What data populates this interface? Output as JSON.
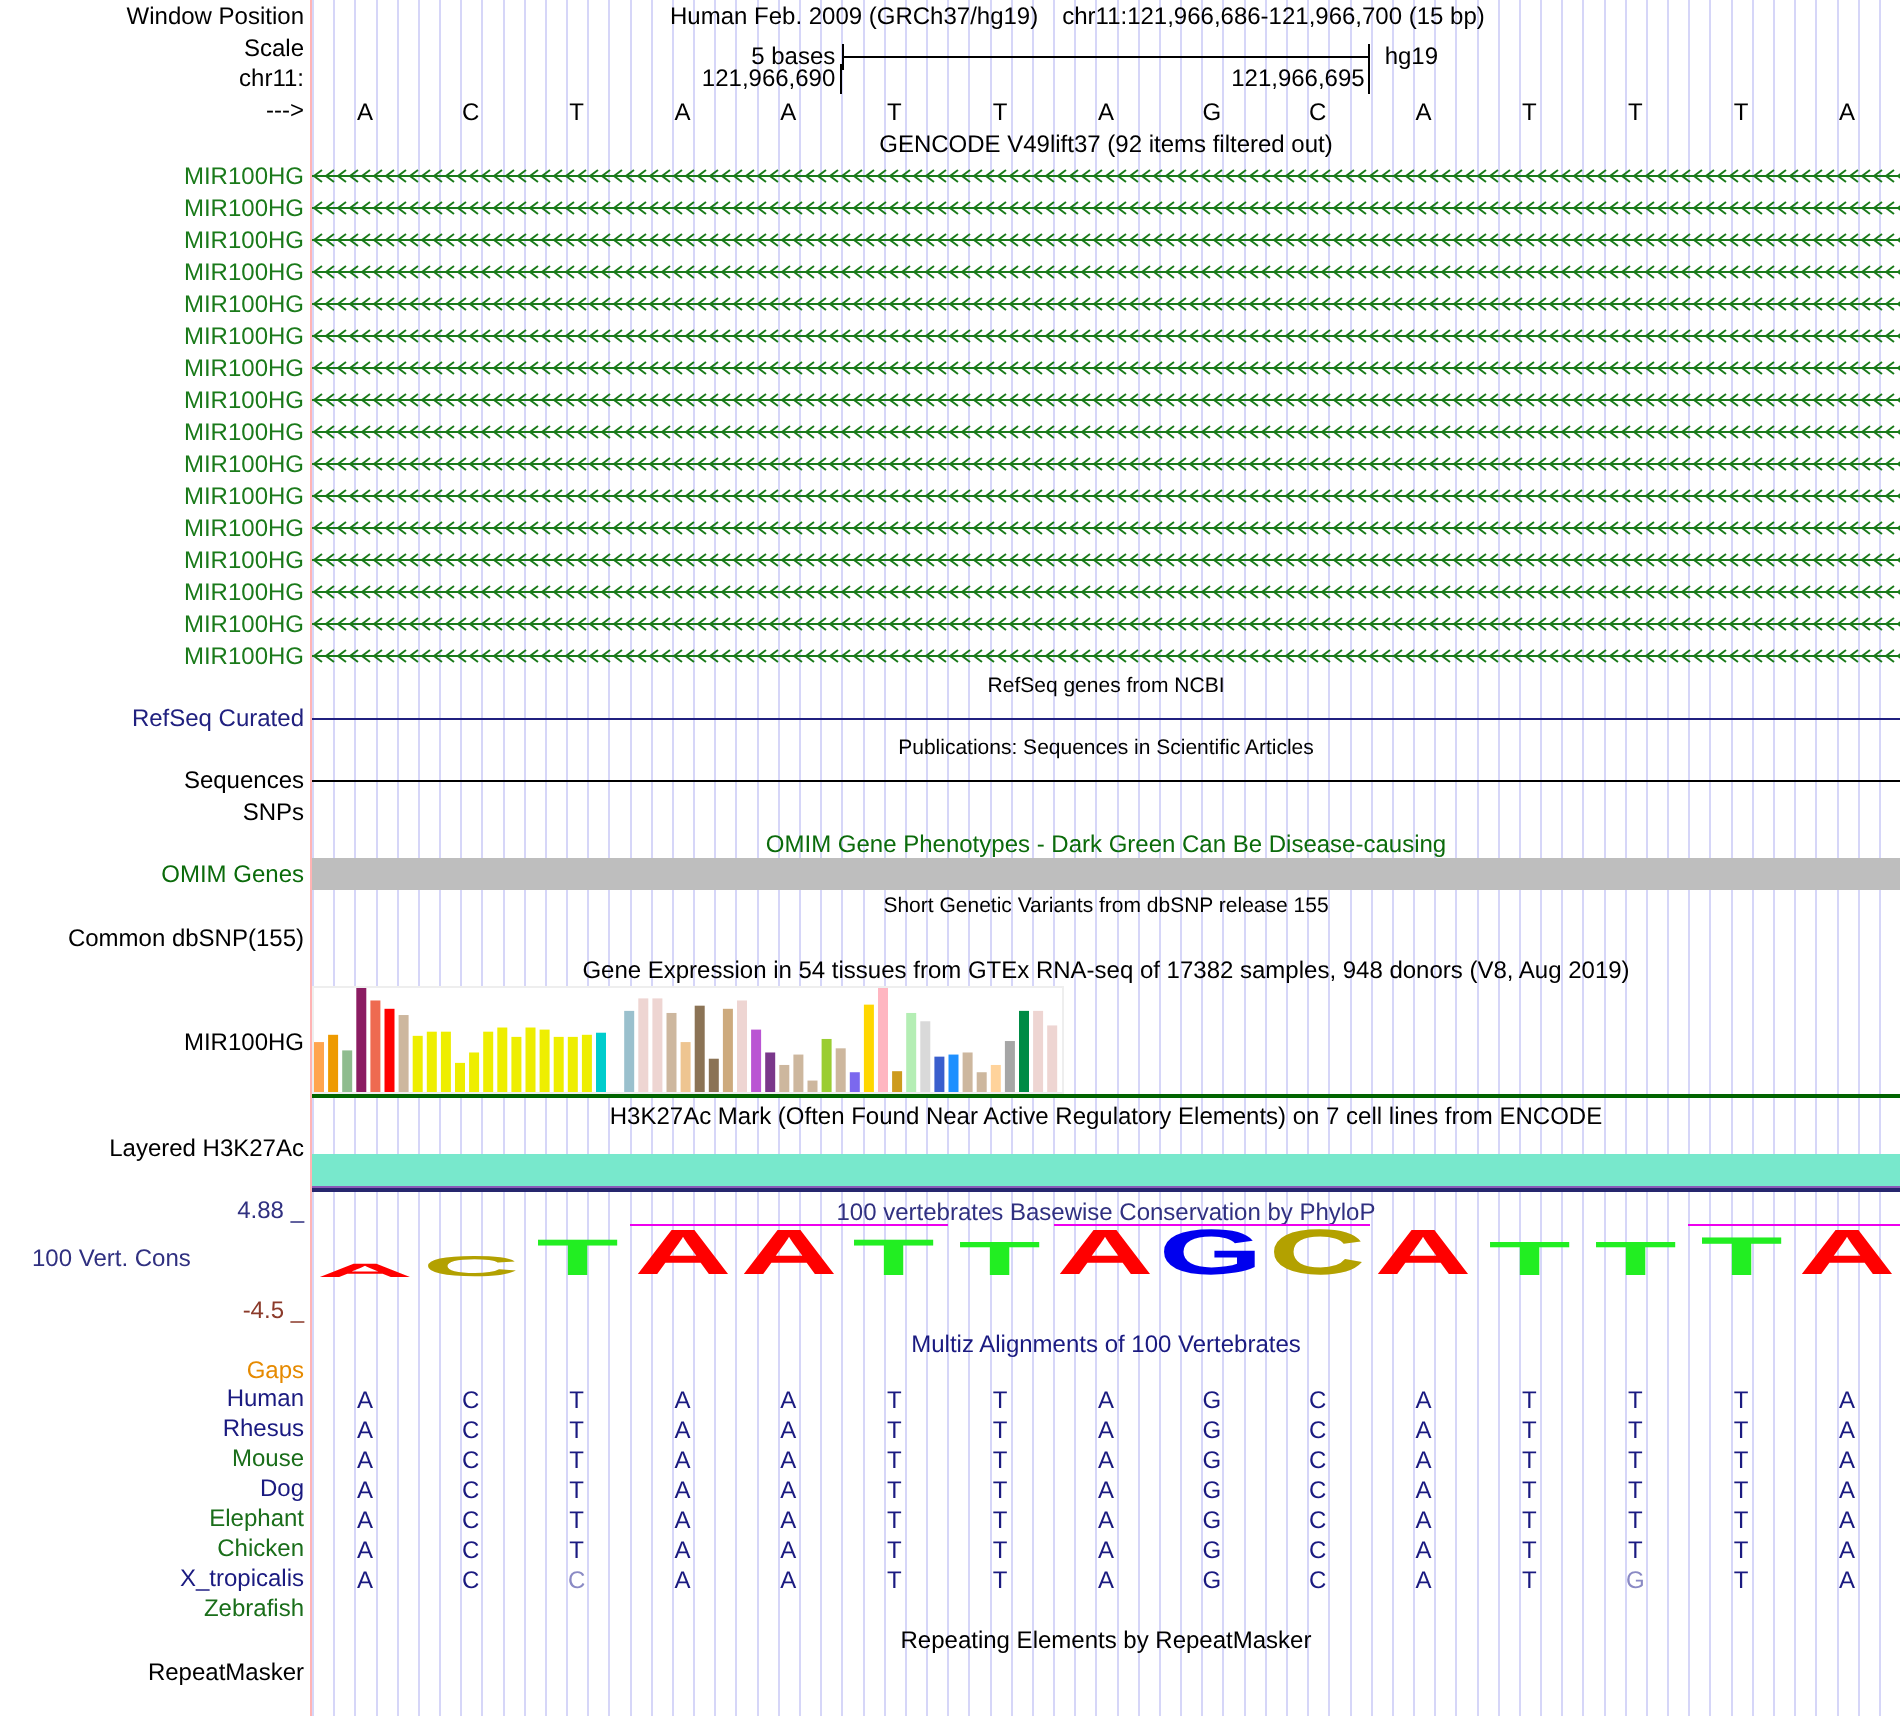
{
  "window_position": {
    "label": "Window Position",
    "assembly": "Human Feb. 2009 (GRCh37/hg19)",
    "range": "chr11:121,966,686-121,966,700 (15 bp)"
  },
  "scale": {
    "label": "Scale",
    "span": "5 bases",
    "assembly": "hg19"
  },
  "coordinates": {
    "label": "chr11:",
    "ticks": [
      "121,966,690",
      "121,966,695"
    ]
  },
  "sequence": {
    "label": "--->",
    "bases": [
      "A",
      "C",
      "T",
      "A",
      "A",
      "T",
      "T",
      "A",
      "G",
      "C",
      "A",
      "T",
      "T",
      "T",
      "A"
    ]
  },
  "tracks": [
    {
      "kind": "genes",
      "title": "GENCODE V49lift37 (92 items filtered out)",
      "items": [
        {
          "label": "MIR100HG",
          "color": "#1a7a1a"
        },
        {
          "label": "MIR100HG",
          "color": "#1a7a1a"
        },
        {
          "label": "MIR100HG",
          "color": "#1a7a1a"
        },
        {
          "label": "MIR100HG",
          "color": "#1a7a1a"
        },
        {
          "label": "MIR100HG",
          "color": "#1a7a1a"
        },
        {
          "label": "MIR100HG",
          "color": "#1a7a1a"
        },
        {
          "label": "MIR100HG",
          "color": "#1a7a1a"
        },
        {
          "label": "MIR100HG",
          "color": "#1a7a1a"
        },
        {
          "label": "MIR100HG",
          "color": "#1a7a1a"
        },
        {
          "label": "MIR100HG",
          "color": "#1a7a1a"
        },
        {
          "label": "MIR100HG",
          "color": "#1a7a1a"
        },
        {
          "label": "MIR100HG",
          "color": "#1a7a1a"
        },
        {
          "label": "MIR100HG",
          "color": "#1a7a1a"
        },
        {
          "label": "MIR100HG",
          "color": "#1a7a1a"
        },
        {
          "label": "MIR100HG",
          "color": "#1a7a1a"
        },
        {
          "label": "MIR100HG",
          "color": "#1a7a1a"
        }
      ]
    },
    {
      "kind": "line",
      "title": "RefSeq genes from NCBI",
      "label": "RefSeq Curated",
      "color": "#20207f"
    },
    {
      "kind": "line",
      "title": "Publications: Sequences in Scientific Articles",
      "label": "Sequences",
      "color": "#000000"
    },
    {
      "kind": "empty",
      "label": "SNPs",
      "color": "#000000"
    },
    {
      "kind": "bar",
      "title": "OMIM Gene Phenotypes - Dark Green Can Be Disease-causing",
      "label": "OMIM Genes",
      "color": "#0b6b0b"
    },
    {
      "kind": "empty",
      "title": "Short Genetic Variants from dbSNP release 155",
      "label": "Common dbSNP(155)",
      "color": "#000000"
    },
    {
      "kind": "expression",
      "title": "Gene Expression in 54 tissues from GTEx RNA-seq of 17382 samples, 948 donors (V8, Aug 2019)",
      "label": "MIR100HG",
      "color": "#000000"
    },
    {
      "kind": "signal",
      "title": "H3K27Ac Mark (Often Found Near Active Regulatory Elements) on 7 cell lines from ENCODE",
      "label": "Layered H3K27Ac",
      "color": "#000000"
    },
    {
      "kind": "conservation",
      "title": "100 vertebrates Basewise Conservation by PhyloP",
      "label": "100 Vert. Cons",
      "color": "#303080",
      "max": "4.88 _",
      "min": "-4.5 _",
      "letters": [
        {
          "base": "A",
          "color": "#ff0000"
        },
        {
          "base": "C",
          "color": "#b3a100"
        },
        {
          "base": "T",
          "color": "#22ee22"
        },
        {
          "base": "A",
          "color": "#ff0000"
        },
        {
          "base": "A",
          "color": "#ff0000"
        },
        {
          "base": "T",
          "color": "#22ee22"
        },
        {
          "base": "T",
          "color": "#22ee22"
        },
        {
          "base": "A",
          "color": "#ff0000"
        },
        {
          "base": "G",
          "color": "#0000ee"
        },
        {
          "base": "C",
          "color": "#b3a100"
        },
        {
          "base": "A",
          "color": "#ff0000"
        },
        {
          "base": "T",
          "color": "#22ee22"
        },
        {
          "base": "T",
          "color": "#22ee22"
        },
        {
          "base": "T",
          "color": "#22ee22"
        },
        {
          "base": "A",
          "color": "#ff0000"
        }
      ]
    },
    {
      "kind": "alignment",
      "title": "Multiz Alignments of 100 Vertebrates",
      "gaps": {
        "label": "Gaps",
        "color": "#e68a00"
      },
      "species": [
        {
          "label": "Human",
          "color": "#1a1a80",
          "bases": [
            {
              "base": "A",
              "faded": false
            },
            {
              "base": "C",
              "faded": false
            },
            {
              "base": "T",
              "faded": false
            },
            {
              "base": "A",
              "faded": false
            },
            {
              "base": "A",
              "faded": false
            },
            {
              "base": "T",
              "faded": false
            },
            {
              "base": "T",
              "faded": false
            },
            {
              "base": "A",
              "faded": false
            },
            {
              "base": "G",
              "faded": false
            },
            {
              "base": "C",
              "faded": false
            },
            {
              "base": "A",
              "faded": false
            },
            {
              "base": "T",
              "faded": false
            },
            {
              "base": "T",
              "faded": false
            },
            {
              "base": "T",
              "faded": false
            },
            {
              "base": "A",
              "faded": false
            }
          ]
        },
        {
          "label": "Rhesus",
          "color": "#1a1a80",
          "bases": [
            {
              "base": "A",
              "faded": false
            },
            {
              "base": "C",
              "faded": false
            },
            {
              "base": "T",
              "faded": false
            },
            {
              "base": "A",
              "faded": false
            },
            {
              "base": "A",
              "faded": false
            },
            {
              "base": "T",
              "faded": false
            },
            {
              "base": "T",
              "faded": false
            },
            {
              "base": "A",
              "faded": false
            },
            {
              "base": "G",
              "faded": false
            },
            {
              "base": "C",
              "faded": false
            },
            {
              "base": "A",
              "faded": false
            },
            {
              "base": "T",
              "faded": false
            },
            {
              "base": "T",
              "faded": false
            },
            {
              "base": "T",
              "faded": false
            },
            {
              "base": "A",
              "faded": false
            }
          ]
        },
        {
          "label": "Mouse",
          "color": "#1a6e1a",
          "bases": [
            {
              "base": "A",
              "faded": false
            },
            {
              "base": "C",
              "faded": false
            },
            {
              "base": "T",
              "faded": false
            },
            {
              "base": "A",
              "faded": false
            },
            {
              "base": "A",
              "faded": false
            },
            {
              "base": "T",
              "faded": false
            },
            {
              "base": "T",
              "faded": false
            },
            {
              "base": "A",
              "faded": false
            },
            {
              "base": "G",
              "faded": false
            },
            {
              "base": "C",
              "faded": false
            },
            {
              "base": "A",
              "faded": false
            },
            {
              "base": "T",
              "faded": false
            },
            {
              "base": "T",
              "faded": false
            },
            {
              "base": "T",
              "faded": false
            },
            {
              "base": "A",
              "faded": false
            }
          ]
        },
        {
          "label": "Dog",
          "color": "#1a1a80",
          "bases": [
            {
              "base": "A",
              "faded": false
            },
            {
              "base": "C",
              "faded": false
            },
            {
              "base": "T",
              "faded": false
            },
            {
              "base": "A",
              "faded": false
            },
            {
              "base": "A",
              "faded": false
            },
            {
              "base": "T",
              "faded": false
            },
            {
              "base": "T",
              "faded": false
            },
            {
              "base": "A",
              "faded": false
            },
            {
              "base": "G",
              "faded": false
            },
            {
              "base": "C",
              "faded": false
            },
            {
              "base": "A",
              "faded": false
            },
            {
              "base": "T",
              "faded": false
            },
            {
              "base": "T",
              "faded": false
            },
            {
              "base": "T",
              "faded": false
            },
            {
              "base": "A",
              "faded": false
            }
          ]
        },
        {
          "label": "Elephant",
          "color": "#1a6e1a",
          "bases": [
            {
              "base": "A",
              "faded": false
            },
            {
              "base": "C",
              "faded": false
            },
            {
              "base": "T",
              "faded": false
            },
            {
              "base": "A",
              "faded": false
            },
            {
              "base": "A",
              "faded": false
            },
            {
              "base": "T",
              "faded": false
            },
            {
              "base": "T",
              "faded": false
            },
            {
              "base": "A",
              "faded": false
            },
            {
              "base": "G",
              "faded": false
            },
            {
              "base": "C",
              "faded": false
            },
            {
              "base": "A",
              "faded": false
            },
            {
              "base": "T",
              "faded": false
            },
            {
              "base": "T",
              "faded": false
            },
            {
              "base": "T",
              "faded": false
            },
            {
              "base": "A",
              "faded": false
            }
          ]
        },
        {
          "label": "Chicken",
          "color": "#1a6e1a",
          "bases": [
            {
              "base": "A",
              "faded": false
            },
            {
              "base": "C",
              "faded": false
            },
            {
              "base": "T",
              "faded": false
            },
            {
              "base": "A",
              "faded": false
            },
            {
              "base": "A",
              "faded": false
            },
            {
              "base": "T",
              "faded": false
            },
            {
              "base": "T",
              "faded": false
            },
            {
              "base": "A",
              "faded": false
            },
            {
              "base": "G",
              "faded": false
            },
            {
              "base": "C",
              "faded": false
            },
            {
              "base": "A",
              "faded": false
            },
            {
              "base": "T",
              "faded": false
            },
            {
              "base": "T",
              "faded": false
            },
            {
              "base": "T",
              "faded": false
            },
            {
              "base": "A",
              "faded": false
            }
          ]
        },
        {
          "label": "X_tropicalis",
          "color": "#1a1a80",
          "bases": [
            {
              "base": "A",
              "faded": false
            },
            {
              "base": "C",
              "faded": false
            },
            {
              "base": "C",
              "faded": true
            },
            {
              "base": "A",
              "faded": false
            },
            {
              "base": "A",
              "faded": false
            },
            {
              "base": "T",
              "faded": false
            },
            {
              "base": "T",
              "faded": false
            },
            {
              "base": "A",
              "faded": false
            },
            {
              "base": "G",
              "faded": false
            },
            {
              "base": "C",
              "faded": false
            },
            {
              "base": "A",
              "faded": false
            },
            {
              "base": "T",
              "faded": false
            },
            {
              "base": "G",
              "faded": true
            },
            {
              "base": "T",
              "faded": false
            },
            {
              "base": "A",
              "faded": false
            }
          ]
        },
        {
          "label": "Zebrafish",
          "color": "#1a6e1a"
        }
      ]
    },
    {
      "kind": "empty",
      "title": "Repeating Elements by RepeatMasker",
      "label": "RepeatMasker",
      "color": "#000000"
    }
  ]
}
